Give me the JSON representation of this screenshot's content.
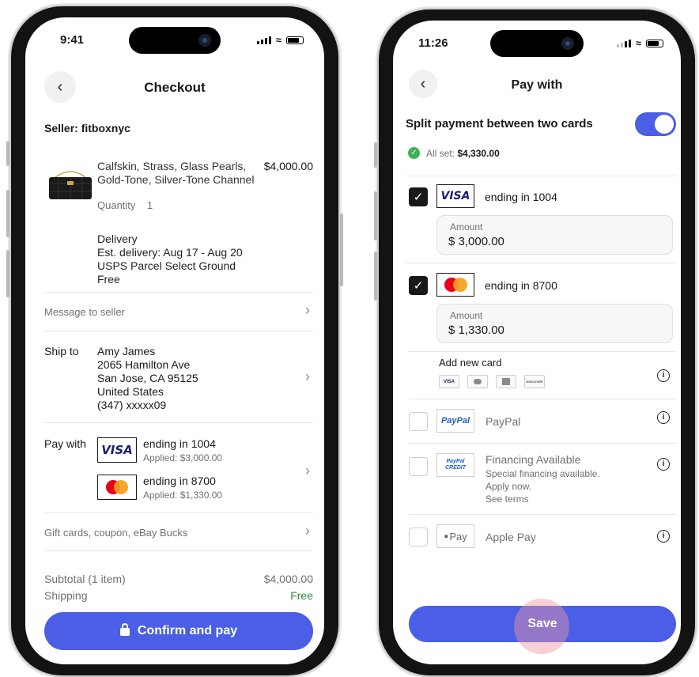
{
  "left": {
    "status_time": "9:41",
    "title": "Checkout",
    "seller": "Seller: fitboxnyc",
    "item": {
      "name_line1": "Calfskin, Strass, Glass Pearls,",
      "name_line2": "Gold-Tone, Silver-Tone Channel",
      "price": "$4,000.00",
      "quantity_label": "Quantity",
      "quantity": "1"
    },
    "delivery": {
      "title": "Delivery",
      "est": "Est. delivery: Aug 17 - Aug 20",
      "service": "USPS Parcel Select Ground",
      "cost": "Free"
    },
    "message_to_seller": "Message to seller",
    "ship_to": {
      "label": "Ship to",
      "name": "Amy James",
      "street": "2065 Hamilton Ave",
      "city": "San Jose, CA 95125",
      "country": "United States",
      "phone": "(347) xxxxx09"
    },
    "pay_with": {
      "label": "Pay with",
      "cards": [
        {
          "logo": "VISA",
          "ending": "ending in 1004",
          "applied": "Applied: $3,000.00"
        },
        {
          "logo": "mastercard-icon",
          "ending": "ending in 8700",
          "applied": "Applied: $1,330.00"
        }
      ]
    },
    "gift_cards": "Gift cards, coupon, eBay Bucks",
    "subtotal_label": "Subtotal (1 item)",
    "subtotal_value": "$4,000.00",
    "shipping_label": "Shipping",
    "shipping_value": "Free",
    "confirm_button": "Confirm and pay"
  },
  "right": {
    "status_time": "11:26",
    "title": "Pay with",
    "split_label": "Split payment between two cards",
    "split_enabled": true,
    "all_set_label": "All set:",
    "all_set_value": "$4,330.00",
    "cards": [
      {
        "logo": "VISA",
        "ending": "ending in 1004",
        "checked": true,
        "amount_label": "Amount",
        "amount": "$ 3,000.00"
      },
      {
        "logo": "mastercard-icon",
        "ending": "ending in 8700",
        "checked": true,
        "amount_label": "Amount",
        "amount": "$ 1,330.00"
      }
    ],
    "add_new_card": "Add new card",
    "mini_cards": [
      "VISA",
      "mastercard-icon",
      "amex-icon",
      "DISCOVER"
    ],
    "options": [
      {
        "logo": "PayPal",
        "label": "PayPal",
        "checked": false
      },
      {
        "logo": "PayPal CREDIT",
        "label": "Financing Available",
        "sub1": "Special financing available.",
        "sub2": "Apply now.",
        "sub3": "See terms",
        "checked": false
      },
      {
        "logo": "Pay",
        "label": "Apple Pay",
        "checked": false
      }
    ],
    "save_button": "Save",
    "accent_color": "#4a5ee6",
    "success_color": "#3db156"
  }
}
